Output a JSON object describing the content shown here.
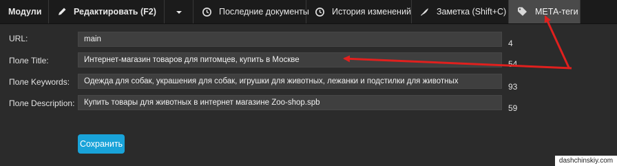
{
  "toolbar": {
    "modules": "Модули",
    "edit": "Редактировать (F2)",
    "recent_docs": "Последние документы",
    "history": "История изменений",
    "note": "Заметка (Shift+C)",
    "meta_tags": "МЕТА-теги"
  },
  "fields": {
    "url": {
      "label": "URL:",
      "value": "main",
      "count": "4"
    },
    "title": {
      "label": "Поле Title:",
      "value": "Интернет-магазин товаров для питомцев, купить в Москве",
      "count": "54"
    },
    "keywords": {
      "label": "Поле Keywords:",
      "value": "Одежда для собак, украшения для собак, игрушки для животных, лежанки и подстилки для животных",
      "count": "93"
    },
    "description": {
      "label": "Поле Description:",
      "value": "Купить товары для животных в интернет магазине Zoo-shop.spb",
      "count": "59"
    }
  },
  "save_label": "Сохранить",
  "watermark": "dashchinskiy.com",
  "colors": {
    "accent": "#19a3d9",
    "annotation": "#e0201e"
  }
}
